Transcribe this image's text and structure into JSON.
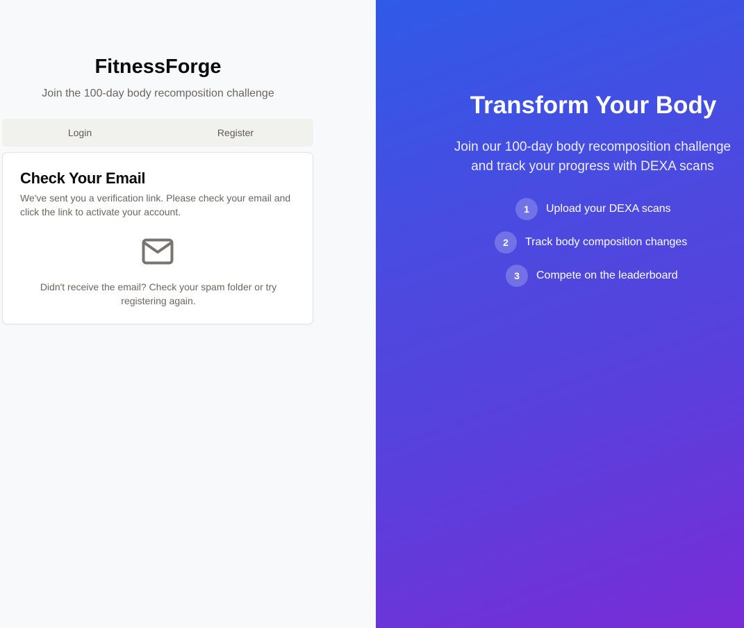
{
  "auth": {
    "brand": "FitnessForge",
    "tagline": "Join the 100-day body recomposition challenge",
    "tabs": [
      "Login",
      "Register"
    ],
    "card": {
      "title": "Check Your Email",
      "description": "We've sent you a verification link. Please check your email and click the link to activate your account.",
      "icon": "mail-icon",
      "footer": "Didn't receive the email? Check your spam folder or try registering again."
    }
  },
  "hero": {
    "title": "Transform Your Body",
    "subtitle_line1": "Join our 100-day body recomposition challenge",
    "subtitle_line2": "and track your progress with DEXA scans",
    "steps": [
      {
        "num": "1",
        "text": "Upload your DEXA scans"
      },
      {
        "num": "2",
        "text": "Track body composition changes"
      },
      {
        "num": "3",
        "text": "Compete on the leaderboard"
      }
    ]
  },
  "colors": {
    "gradient_start": "#2f5ae8",
    "gradient_end": "#7a2cd6",
    "muted_text": "#6b6560",
    "icon": "#7a746e"
  }
}
